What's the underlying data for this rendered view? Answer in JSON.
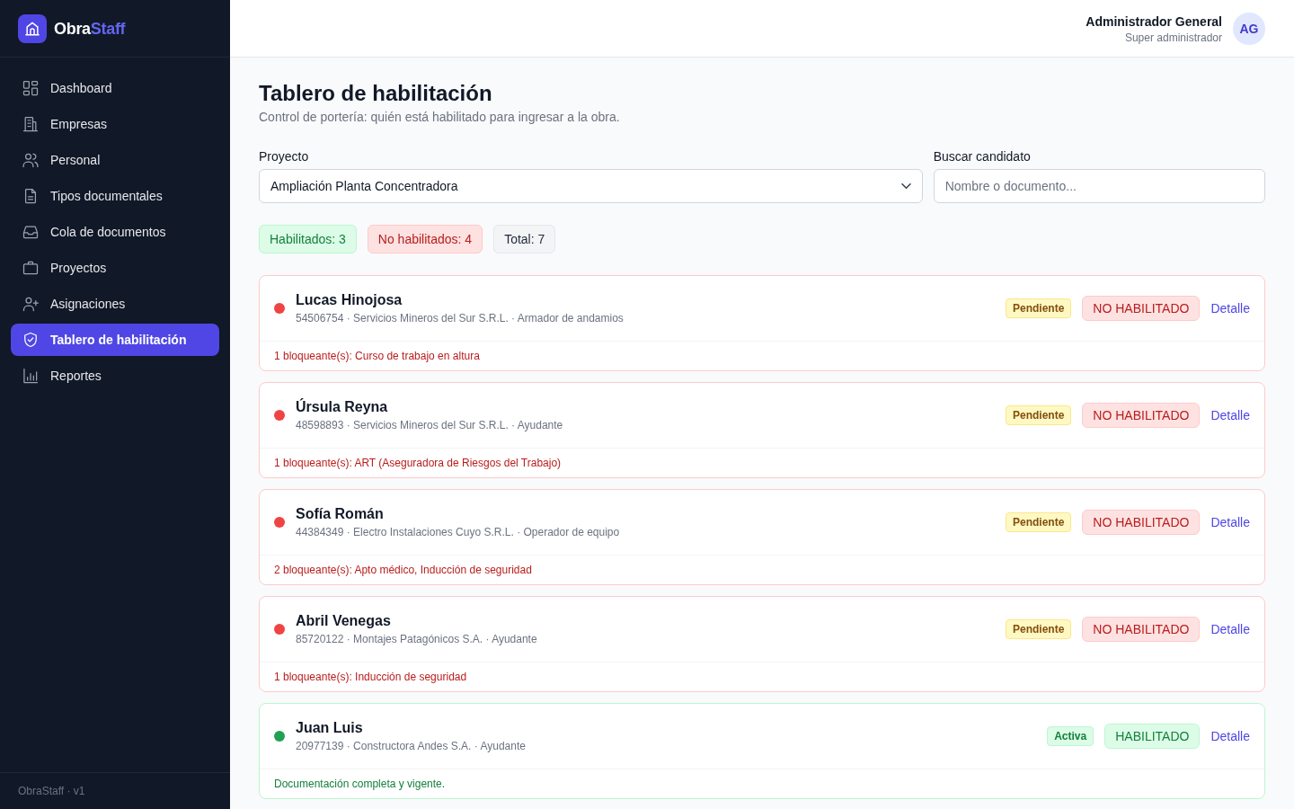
{
  "sidebar": {
    "brand": {
      "name_main": "Obra",
      "name_accent": "Staff"
    },
    "items": [
      {
        "label": "Dashboard",
        "selected": false
      },
      {
        "label": "Empresas",
        "selected": false
      },
      {
        "label": "Personal",
        "selected": false
      },
      {
        "label": "Tipos documentales",
        "selected": false
      },
      {
        "label": "Cola de documentos",
        "selected": false
      },
      {
        "label": "Proyectos",
        "selected": false
      },
      {
        "label": "Asignaciones",
        "selected": false
      },
      {
        "label": "Tablero de habilitación",
        "selected": true
      },
      {
        "label": "Reportes",
        "selected": false
      }
    ],
    "footer": "ObraStaff · v1"
  },
  "header": {
    "user": {
      "name": "Administrador General",
      "role": "Super administrador",
      "initials": "AG"
    }
  },
  "page": {
    "title": "Tablero de habilitación",
    "subtitle": "Control de portería: quién está habilitado para ingresar a la obra."
  },
  "filters": {
    "project": {
      "label": "Proyecto",
      "value": "Ampliación Planta Concentradora"
    },
    "search": {
      "label": "Buscar candidato",
      "placeholder": "Nombre o documento..."
    }
  },
  "summary": [
    {
      "kind": "ok",
      "label": "Habilitados: 3"
    },
    {
      "kind": "blocked",
      "label": "No habilitados: 4"
    },
    {
      "kind": "total",
      "label": "Total: 7"
    }
  ],
  "workers": [
    {
      "name": "Lucas Hinojosa",
      "details": "54506754 · Servicios Mineros del Sur S.R.L. · Armador de andamios",
      "enabled": false,
      "assignment": {
        "label": "Pendiente",
        "kind": "pending"
      },
      "status": "NO HABILITADO",
      "action": "Detalle",
      "note": "1 bloqueante(s): Curso de trabajo en altura"
    },
    {
      "name": "Úrsula Reyna",
      "details": "48598893 · Servicios Mineros del Sur S.R.L. · Ayudante",
      "enabled": false,
      "assignment": {
        "label": "Pendiente",
        "kind": "pending"
      },
      "status": "NO HABILITADO",
      "action": "Detalle",
      "note": "1 bloqueante(s): ART (Aseguradora de Riesgos del Trabajo)"
    },
    {
      "name": "Sofía Román",
      "details": "44384349 · Electro Instalaciones Cuyo S.R.L. · Operador de equipo",
      "enabled": false,
      "assignment": {
        "label": "Pendiente",
        "kind": "pending"
      },
      "status": "NO HABILITADO",
      "action": "Detalle",
      "note": "2 bloqueante(s): Apto médico, Inducción de seguridad"
    },
    {
      "name": "Abril Venegas",
      "details": "85720122 · Montajes Patagónicos S.A. · Ayudante",
      "enabled": false,
      "assignment": {
        "label": "Pendiente",
        "kind": "pending"
      },
      "status": "NO HABILITADO",
      "action": "Detalle",
      "note": "1 bloqueante(s): Inducción de seguridad"
    },
    {
      "name": "Juan Luis",
      "details": "20977139 · Constructora Andes S.A. · Ayudante",
      "enabled": true,
      "assignment": {
        "label": "Activa",
        "kind": "active"
      },
      "status": "HABILITADO",
      "action": "Detalle",
      "note": "Documentación completa y vigente."
    }
  ]
}
